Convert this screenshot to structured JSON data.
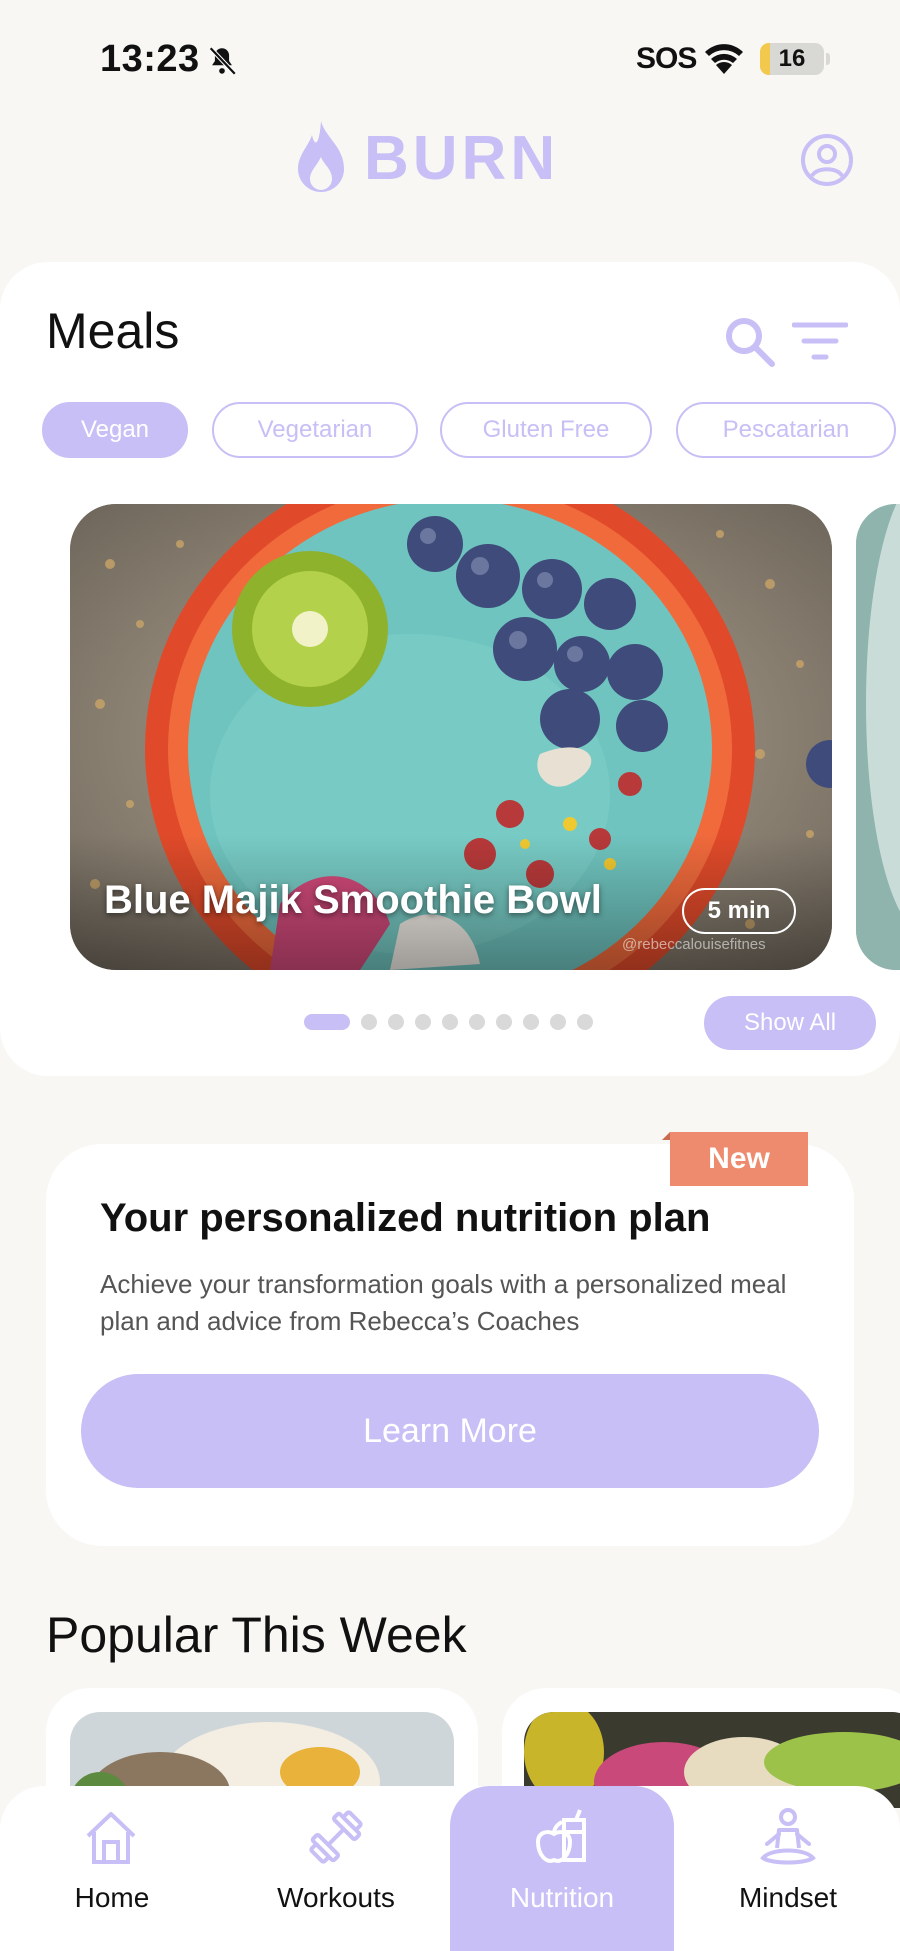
{
  "status_bar": {
    "time": "13:23",
    "carrier": "SOS",
    "battery": "16",
    "battery_level": 0.16
  },
  "app": {
    "brand": "BURN"
  },
  "meals": {
    "title": "Meals",
    "filters": [
      "Vegan",
      "Vegetarian",
      "Gluten Free",
      "Pescatarian"
    ],
    "active_filter": "Vegan",
    "featured": {
      "name": "Blue Majik Smoothie Bowl",
      "time": "5 min",
      "watermark": "@rebeccalouisefitnes"
    },
    "slides_count": 10,
    "active_slide": 1,
    "show_all_label": "Show All"
  },
  "plan": {
    "badge": "New",
    "title": "Your personalized nutrition plan",
    "description": "Achieve your transformation goals with a personalized meal plan and advice from Rebecca’s Coaches",
    "cta": "Learn More"
  },
  "popular": {
    "title": "Popular This Week"
  },
  "nav": {
    "items": [
      {
        "label": "Home",
        "icon": "home-icon"
      },
      {
        "label": "Workouts",
        "icon": "dumbbell-icon"
      },
      {
        "label": "Nutrition",
        "icon": "nutrition-icon"
      },
      {
        "label": "Mindset",
        "icon": "meditation-icon"
      }
    ],
    "active": "Nutrition"
  },
  "colors": {
    "accent": "#c7bff5",
    "badge": "#ee8b6e",
    "background": "#f8f7f4"
  }
}
